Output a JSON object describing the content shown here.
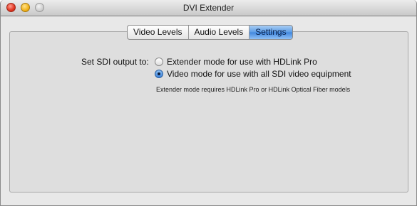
{
  "window": {
    "title": "DVI Extender"
  },
  "tabs": [
    {
      "label": "Video Levels",
      "active": false
    },
    {
      "label": "Audio Levels",
      "active": false
    },
    {
      "label": "Settings",
      "active": true
    }
  ],
  "settings": {
    "sdi_label": "Set SDI output to:",
    "options": [
      {
        "label": "Extender mode for use with HDLink Pro",
        "selected": false
      },
      {
        "label": "Video mode for use with all SDI video equipment",
        "selected": true
      }
    ],
    "note": "Extender mode requires HDLink Pro or HDLink Optical Fiber models"
  }
}
